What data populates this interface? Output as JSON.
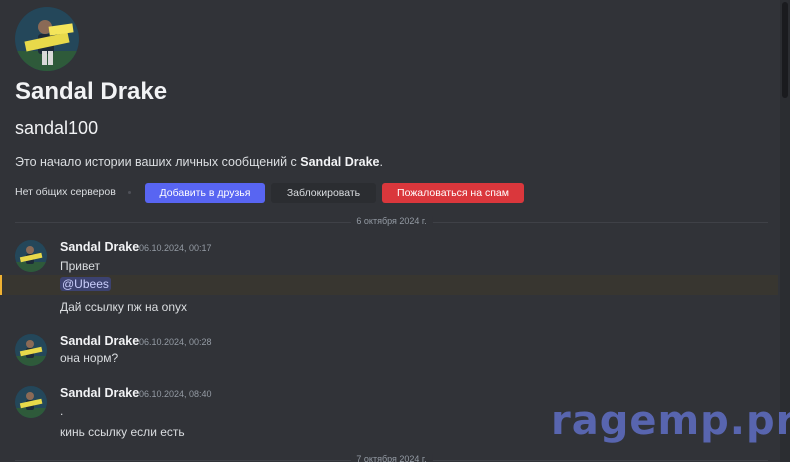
{
  "profile": {
    "display_name": "Sandal Drake",
    "username": "sandal100",
    "intro_prefix": "Это начало истории ваших личных сообщений с ",
    "intro_name": "Sandal Drake",
    "intro_suffix": ".",
    "mutual_servers": "Нет общих серверов"
  },
  "actions": {
    "add_friend": "Добавить в друзья",
    "block": "Заблокировать",
    "report_spam": "Пожаловаться на спам"
  },
  "colors": {
    "background": "#313338",
    "add_friend": "#5865f2",
    "report_spam": "#da373c",
    "mention_highlight": "#f0b232"
  },
  "dividers": [
    "6 октября 2024 г.",
    "7 октября 2024 г."
  ],
  "messages": [
    {
      "author": "Sandal Drake",
      "timestamp": "06.10.2024, 00:17",
      "lines": [
        "Привет",
        "Дай ссылку пж на onyx"
      ],
      "mention": "@Ubees"
    },
    {
      "author": "Sandal Drake",
      "timestamp": "06.10.2024, 00:28",
      "lines": [
        "она норм?"
      ]
    },
    {
      "author": "Sandal Drake",
      "timestamp": "06.10.2024, 08:40",
      "lines": [
        ".",
        "кинь ссылку если есть"
      ]
    }
  ],
  "watermark": "ragemp.pro"
}
